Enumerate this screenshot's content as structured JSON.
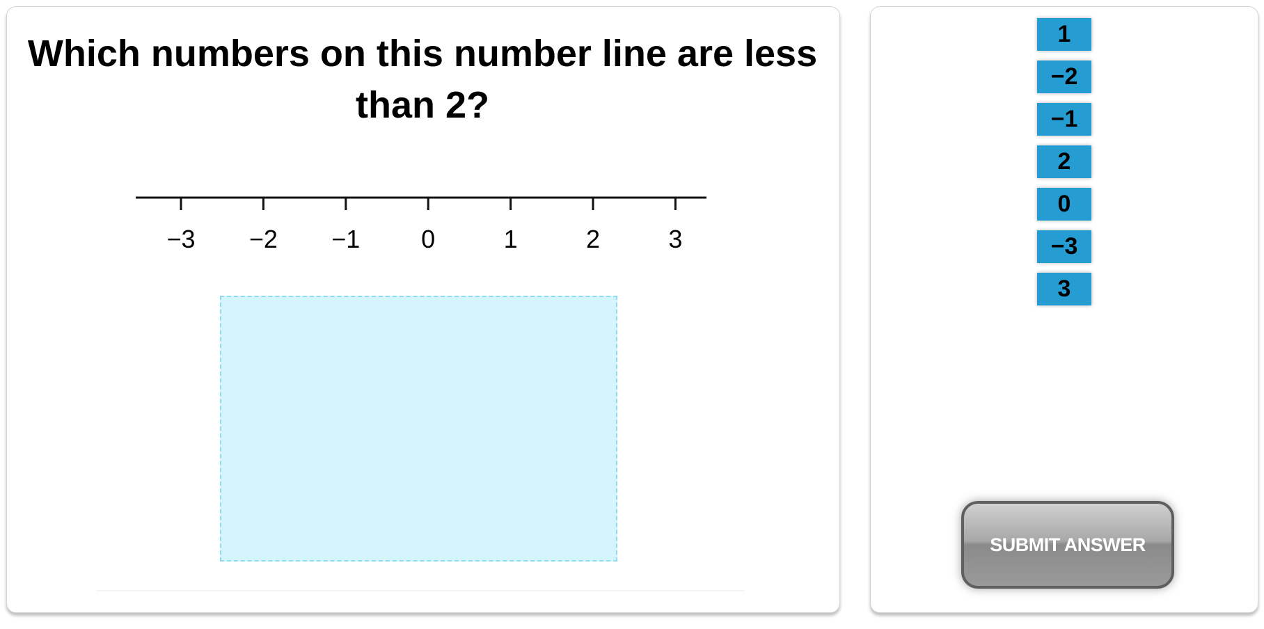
{
  "question": {
    "title": "Which numbers on this number line are less than 2?"
  },
  "number_line": {
    "min": -3,
    "max": 3,
    "tick_labels": [
      "−3",
      "−2",
      "−1",
      "0",
      "1",
      "2",
      "3"
    ]
  },
  "answer_tiles": [
    "1",
    "−2",
    "−1",
    "2",
    "0",
    "−3",
    "3"
  ],
  "submit": {
    "label": "SUBMIT ANSWER"
  },
  "colors": {
    "tile": "#269dd2",
    "drop_zone": "#d6f4fb",
    "drop_zone_border": "#8fdcf1"
  }
}
